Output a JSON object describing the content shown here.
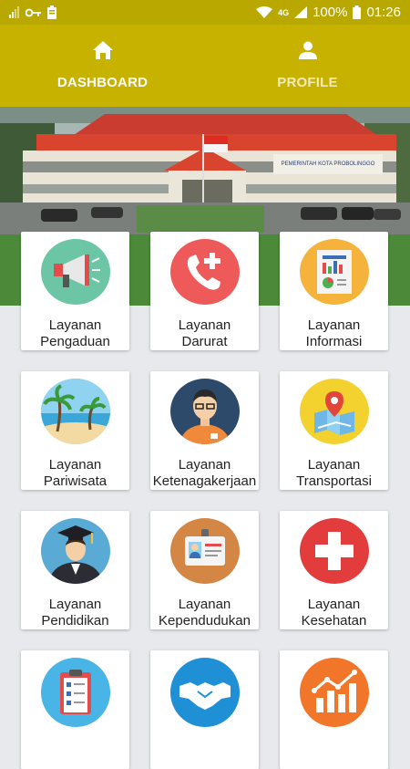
{
  "status_bar": {
    "battery": "100%",
    "time": "01:26",
    "network": "4G"
  },
  "tabs": [
    {
      "label": "DASHBOARD",
      "icon": "home-icon",
      "active": true
    },
    {
      "label": "PROFILE",
      "icon": "person-icon",
      "active": false
    }
  ],
  "hero": {
    "building_sign": "PEMERINTAH KOTA PROBOLINGGO"
  },
  "menu": [
    {
      "line1": "Layanan",
      "line2": "Pengaduan",
      "icon": "megaphone-icon",
      "color": "#6cc5a4"
    },
    {
      "line1": "Layanan",
      "line2": "Darurat",
      "icon": "emergency-phone-icon",
      "color": "#ee5a5a"
    },
    {
      "line1": "Layanan",
      "line2": "Informasi",
      "icon": "report-chart-icon",
      "color": "#f5b33b"
    },
    {
      "line1": "Layanan",
      "line2": "Pariwisata",
      "icon": "beach-palm-icon",
      "color": "#7ec8e8"
    },
    {
      "line1": "Layanan",
      "line2": "Ketenagakerjaan",
      "icon": "worker-icon",
      "color": "#2d4a6b"
    },
    {
      "line1": "Layanan",
      "line2": "Transportasi",
      "icon": "map-pin-icon",
      "color": "#f3d12f"
    },
    {
      "line1": "Layanan",
      "line2": "Pendidikan",
      "icon": "graduate-icon",
      "color": "#5aaad6"
    },
    {
      "line1": "Layanan",
      "line2": "Kependudukan",
      "icon": "id-card-icon",
      "color": "#d48644"
    },
    {
      "line1": "Layanan",
      "line2": "Kesehatan",
      "icon": "medical-cross-icon",
      "color": "#e23c3c"
    },
    {
      "line1": "",
      "line2": "",
      "icon": "checklist-icon",
      "color": "#49b4e6"
    },
    {
      "line1": "",
      "line2": "",
      "icon": "handshake-icon",
      "color": "#1f8fd6"
    },
    {
      "line1": "",
      "line2": "",
      "icon": "growth-chart-icon",
      "color": "#f2762a"
    }
  ]
}
